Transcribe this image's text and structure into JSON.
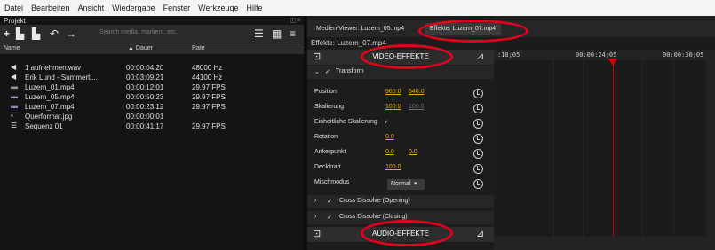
{
  "menubar": {
    "items": [
      "Datei",
      "Bearbeiten",
      "Ansicht",
      "Wiedergabe",
      "Fenster",
      "Werkzeuge",
      "Hilfe"
    ]
  },
  "project": {
    "title": "Projekt",
    "search_placeholder": "Search media, markers, etc.",
    "columns": {
      "name": "Name",
      "duration": "▲ Dauer",
      "rate": "Rate"
    },
    "rows": [
      {
        "icon": "audio-icon",
        "name": "1 aufnehmen.wav",
        "duration": "00:00:04:20",
        "rate": "48000 Hz"
      },
      {
        "icon": "audio-icon",
        "name": "Erik Lund - Summerti...",
        "duration": "00:03:09:21",
        "rate": "44100 Hz"
      },
      {
        "icon": "video-icon",
        "name": "Luzern_01.mp4",
        "duration": "00:00:12:01",
        "rate": "29.97 FPS"
      },
      {
        "icon": "video-icon",
        "name": "Luzern_05.mp4",
        "duration": "00:00:50:23",
        "rate": "29.97 FPS"
      },
      {
        "icon": "video-icon",
        "name": "Luzern_07.mp4",
        "duration": "00:00:23:12",
        "rate": "29.97 FPS"
      },
      {
        "icon": "image-icon",
        "name": "Querformat.jpg",
        "duration": "00:00:00:01",
        "rate": ""
      },
      {
        "icon": "sequence-icon",
        "name": "Sequenz 01",
        "duration": "00:00:41:17",
        "rate": "29.97 FPS"
      }
    ]
  },
  "tabs": [
    {
      "label": "Medien-Viewer: Luzern_05.mp4",
      "active": false
    },
    {
      "label": "Effekte: Luzern_07.mp4",
      "active": true
    }
  ],
  "effects": {
    "title": "Effekte: Luzern_07.mp4",
    "video_header": "VIDEO-EFFEKTE",
    "audio_header": "AUDIO-EFFEKTE",
    "transform": {
      "label": "Transform",
      "properties": {
        "position": {
          "label": "Position",
          "x": "960.0",
          "y": "540.0"
        },
        "scale": {
          "label": "Skalierung",
          "x": "100.0",
          "y": "100.0"
        },
        "uniform_scale": {
          "label": "Einheitliche Skalierung",
          "checked": "✓"
        },
        "rotation": {
          "label": "Rotation",
          "value": "0.0"
        },
        "anchor": {
          "label": "Ankerpunkt",
          "x": "0.0",
          "y": "0.0"
        },
        "opacity": {
          "label": "Deckkraft",
          "value": "100.0"
        },
        "blend": {
          "label": "Mischmodus",
          "value": "Normal"
        }
      }
    },
    "cross_opening": "Cross Dissolve (Opening)",
    "cross_closing": "Cross Dissolve (Closing)"
  },
  "timeline": {
    "ticks": [
      ":18;05",
      "00:00:24;05",
      "00:00:30;05"
    ]
  },
  "colors": {
    "accent_value": "#e5b000",
    "annotation_red": "#e4001b",
    "playhead": "#e00000"
  }
}
